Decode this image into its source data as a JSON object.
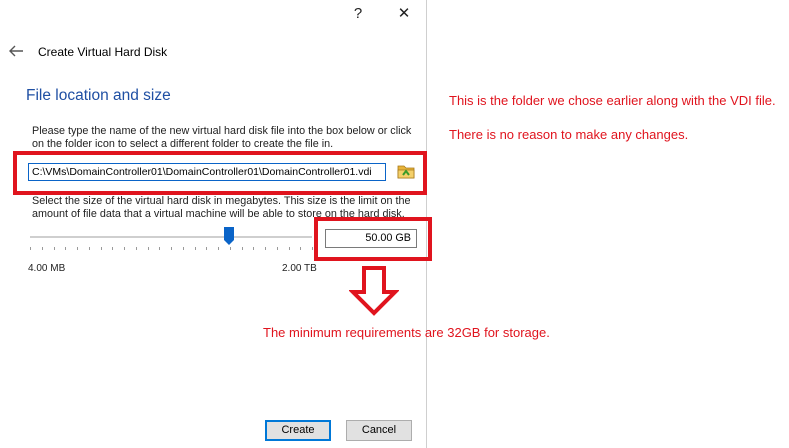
{
  "titlebar": {
    "help_label": "?",
    "close_label": "✕"
  },
  "dialog": {
    "title": "Create Virtual Hard Disk",
    "section_heading": "File location and size",
    "location_description": "Please type the name of the new virtual hard disk file into the box below or click on the folder icon to select a different folder to create the file in.",
    "location_value": "C:\\VMs\\DomainController01\\DomainController01\\DomainController01.vdi",
    "size_description": "Select the size of the virtual hard disk in megabytes. This size is the limit on the amount of file data that a virtual machine will be able to store on the hard disk.",
    "slider": {
      "min_label": "4.00 MB",
      "max_label": "2.00 TB",
      "position_fraction": 0.705
    },
    "size_value": "50.00 GB",
    "buttons": {
      "create": "Create",
      "cancel": "Cancel"
    }
  },
  "annotations": {
    "folder_note_line1": "This is the folder we chose earlier along with the VDI file.",
    "folder_note_line2": "There is no reason to make any changes.",
    "size_note": "The minimum requirements are 32GB for storage."
  },
  "colors": {
    "highlight": "#e0141e",
    "heading": "#1f4fa3",
    "accent": "#0078d7"
  },
  "icons": {
    "back": "back-arrow-icon",
    "folder": "folder-icon",
    "annotation_arrow": "down-arrow-icon"
  }
}
